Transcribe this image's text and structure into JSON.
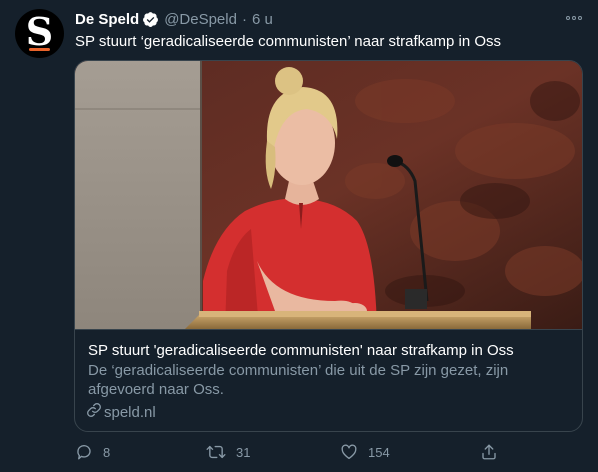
{
  "author": {
    "name": "De Speld",
    "handle": "@DeSpeld",
    "separator": "·",
    "time": "6 u",
    "avatar_letter": "S"
  },
  "tweet": {
    "text": "SP stuurt ‘geradicaliseerde communisten’ naar strafkamp in Oss"
  },
  "card": {
    "title": "SP stuurt 'geradicaliseerde communisten' naar strafkamp in Oss",
    "description": "De ‘geradicaliseerde communisten’ die uit de SP zijn gezet, zijn afgevoerd naar Oss.",
    "domain": "speld.nl"
  },
  "actions": {
    "reply_count": "8",
    "retweet_count": "31",
    "like_count": "154"
  },
  "icons": {
    "verified": "verified-badge-icon",
    "more": "more-options-icon",
    "link": "link-icon",
    "reply": "reply-icon",
    "retweet": "retweet-icon",
    "like": "heart-icon",
    "share": "share-icon"
  },
  "colors": {
    "background": "#15202b",
    "text_primary": "#ffffff",
    "text_secondary": "#8899a6",
    "border": "#38444d",
    "brand_accent": "#e8632b"
  }
}
